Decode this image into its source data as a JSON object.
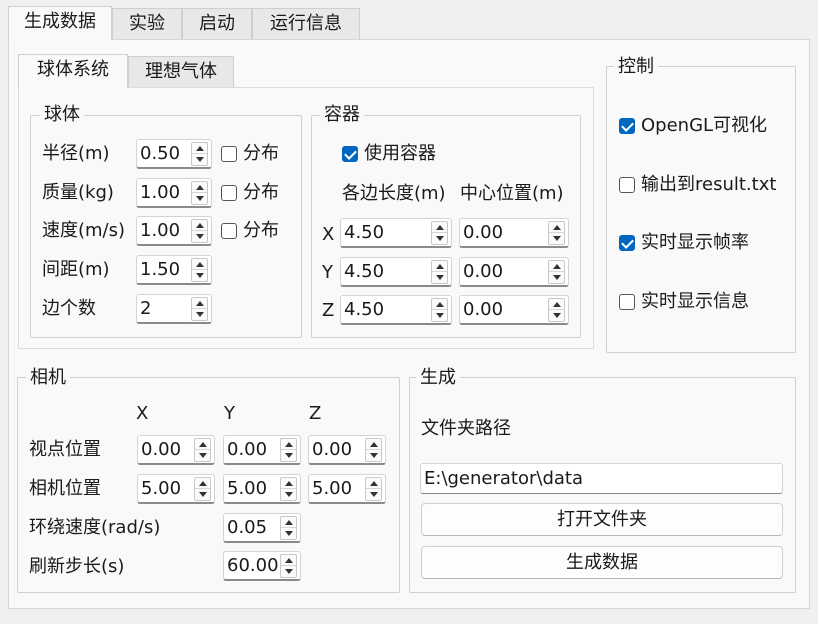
{
  "tabs": [
    "生成数据",
    "实验",
    "启动",
    "运行信息"
  ],
  "subtabs": [
    "球体系统",
    "理想气体"
  ],
  "ball": {
    "title": "球体",
    "rows": [
      {
        "label": "半径(m)",
        "value": "0.50",
        "dist": "分布",
        "dist_checked": false
      },
      {
        "label": "质量(kg)",
        "value": "1.00",
        "dist": "分布",
        "dist_checked": false
      },
      {
        "label": "速度(m/s)",
        "value": "1.00",
        "dist": "分布",
        "dist_checked": false
      },
      {
        "label": "间距(m)",
        "value": "1.50"
      },
      {
        "label": "边个数",
        "value": "2"
      }
    ]
  },
  "container": {
    "title": "容器",
    "use_label": "使用容器",
    "use_checked": true,
    "col_length": "各边长度(m)",
    "col_center": "中心位置(m)",
    "rows": [
      {
        "axis": "X",
        "length": "4.50",
        "center": "0.00"
      },
      {
        "axis": "Y",
        "length": "4.50",
        "center": "0.00"
      },
      {
        "axis": "Z",
        "length": "4.50",
        "center": "0.00"
      }
    ]
  },
  "control": {
    "title": "控制",
    "items": [
      {
        "label": "OpenGL可视化",
        "checked": true
      },
      {
        "label": "输出到result.txt",
        "checked": false
      },
      {
        "label": "实时显示帧率",
        "checked": true
      },
      {
        "label": "实时显示信息",
        "checked": false
      }
    ]
  },
  "camera": {
    "title": "相机",
    "cols": [
      "X",
      "Y",
      "Z"
    ],
    "viewpoint_label": "视点位置",
    "viewpoint": [
      "0.00",
      "0.00",
      "0.00"
    ],
    "position_label": "相机位置",
    "position": [
      "5.00",
      "5.00",
      "5.00"
    ],
    "orbit_label": "环绕速度(rad/s)",
    "orbit": "0.05",
    "refresh_label": "刷新步长(s)",
    "refresh": "60.00"
  },
  "generate": {
    "title": "生成",
    "folder_label": "文件夹路径",
    "folder_path": "E:\\generator\\data",
    "open_button": "打开文件夹",
    "generate_button": "生成数据"
  },
  "colors": {
    "accent": "#0067c0"
  }
}
